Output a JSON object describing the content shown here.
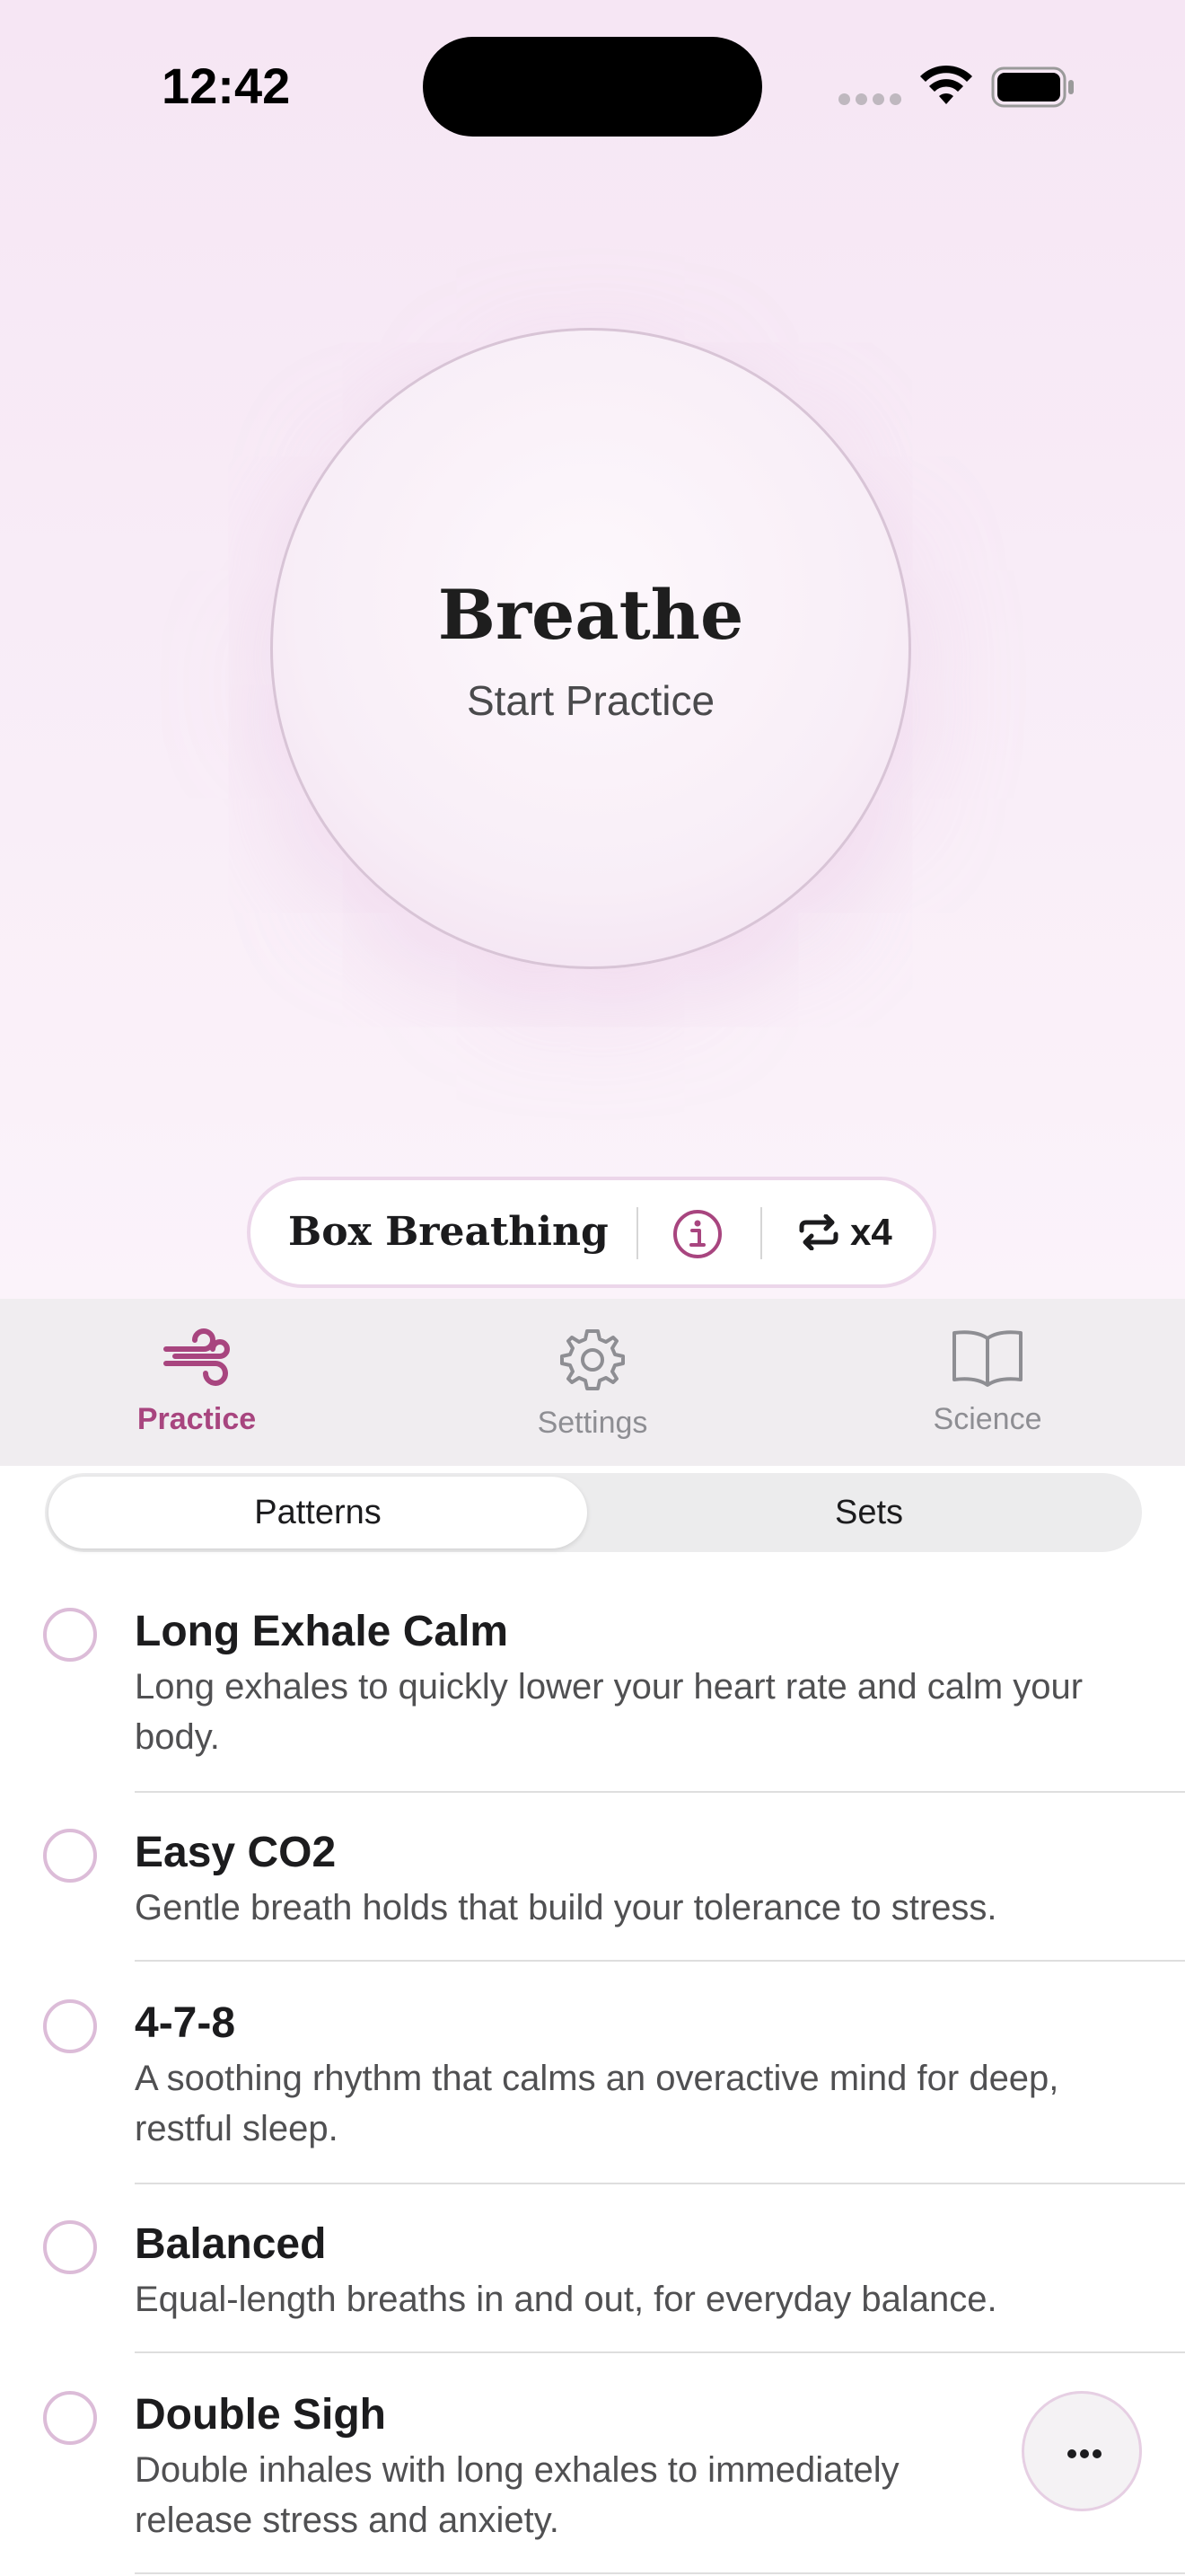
{
  "status_bar": {
    "time": "12:42",
    "icons": [
      "cellular-icon",
      "wifi-icon",
      "battery-icon"
    ]
  },
  "breathe": {
    "title": "Breathe",
    "subtitle": "Start Practice"
  },
  "pattern_pill": {
    "name": "Box Breathing",
    "info_icon": "info-icon",
    "repeat_icon": "repeat-icon",
    "repeat_count": "x4"
  },
  "tabs": [
    {
      "label": "Practice",
      "icon": "wind-icon",
      "active": true
    },
    {
      "label": "Settings",
      "icon": "gear-icon",
      "active": false
    },
    {
      "label": "Science",
      "icon": "book-icon",
      "active": false
    }
  ],
  "segments": {
    "selected": "Patterns",
    "items": [
      "Patterns",
      "Sets"
    ]
  },
  "patterns": [
    {
      "title": "Long Exhale Calm",
      "description": "Long exhales to quickly lower your heart rate and calm your body."
    },
    {
      "title": "Easy CO2",
      "description": "Gentle breath holds that build your tolerance to stress."
    },
    {
      "title": "4-7-8",
      "description": "A soothing rhythm that calms an overactive mind for deep, restful sleep."
    },
    {
      "title": "Balanced",
      "description": "Equal-length breaths in and out, for everyday balance."
    },
    {
      "title": "Double Sigh",
      "description": "Double inhales with long exhales to immediately release stress and anxiety."
    }
  ],
  "more_button_icon": "ellipsis-icon",
  "colors": {
    "accent": "#a8457f",
    "inactive": "#8e8e93",
    "background_top": "#f6e6f4",
    "radio_border": "#dcbcd8"
  }
}
